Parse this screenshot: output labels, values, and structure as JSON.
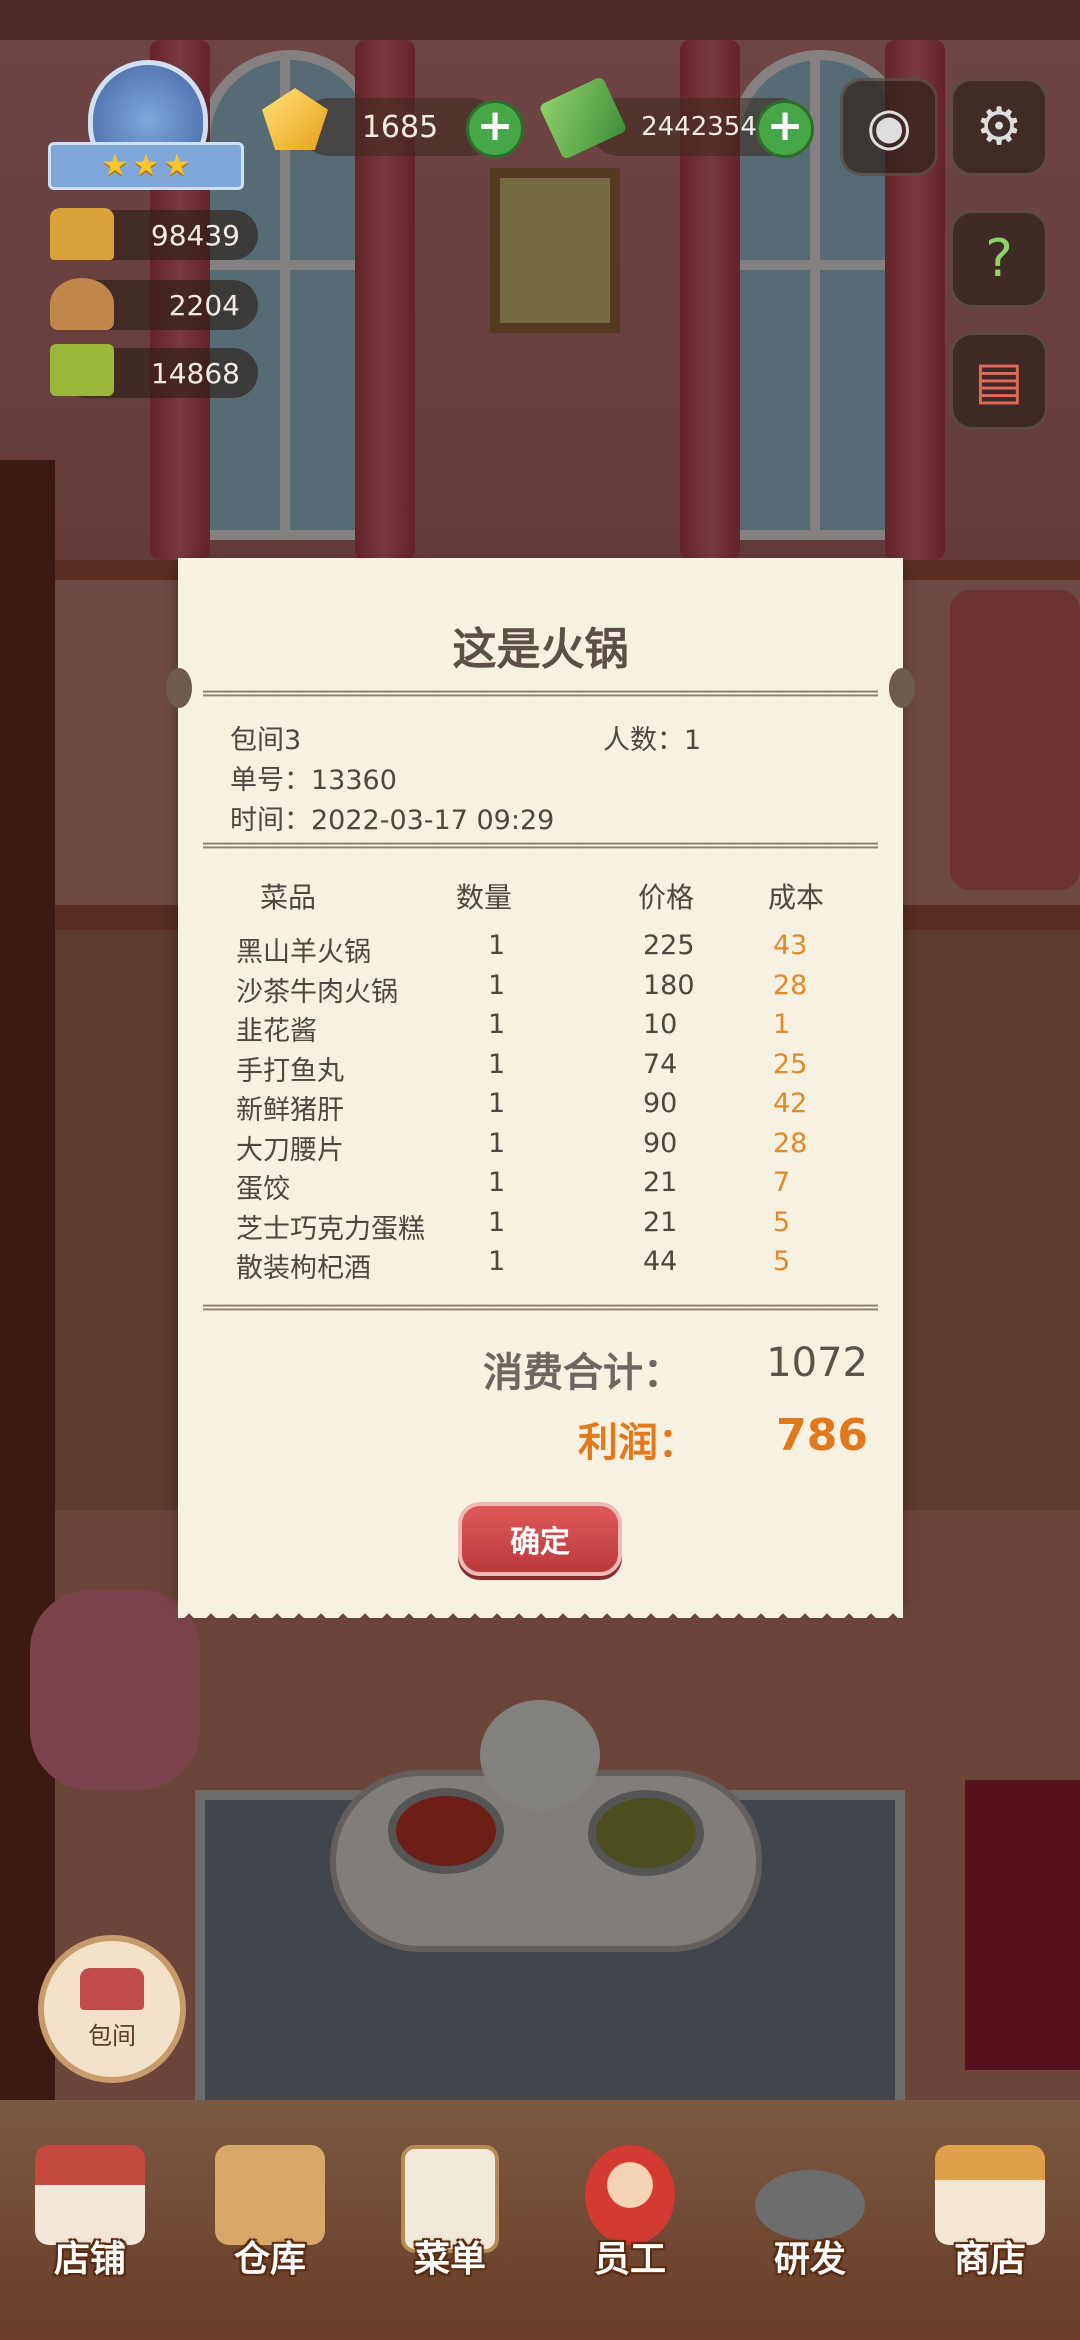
{
  "hud": {
    "gems": "1685",
    "cash": "2442354",
    "stars": 3,
    "side_stats": [
      "98439",
      "2204",
      "14868"
    ]
  },
  "receipt": {
    "title": "这是火锅",
    "room": "包间3",
    "guests_label": "人数：",
    "guests": "1",
    "order_label": "单号：",
    "order_no": "13360",
    "time_label": "时间：",
    "time": "2022-03-17 09:29",
    "headers": {
      "dish": "菜品",
      "qty": "数量",
      "price": "价格",
      "cost": "成本"
    },
    "items": [
      {
        "name": "黑山羊火锅",
        "qty": "1",
        "price": "225",
        "cost": "43"
      },
      {
        "name": "沙茶牛肉火锅",
        "qty": "1",
        "price": "180",
        "cost": "28"
      },
      {
        "name": "韭花酱",
        "qty": "1",
        "price": "10",
        "cost": "1"
      },
      {
        "name": "手打鱼丸",
        "qty": "1",
        "price": "74",
        "cost": "25"
      },
      {
        "name": "新鲜猪肝",
        "qty": "1",
        "price": "90",
        "cost": "42"
      },
      {
        "name": "大刀腰片",
        "qty": "1",
        "price": "90",
        "cost": "28"
      },
      {
        "name": "蛋饺",
        "qty": "1",
        "price": "21",
        "cost": "7"
      },
      {
        "name": "芝士巧克力蛋糕",
        "qty": "1",
        "price": "21",
        "cost": "5"
      },
      {
        "name": "散装枸杞酒",
        "qty": "1",
        "price": "44",
        "cost": "5"
      }
    ],
    "total_label": "消费合计：",
    "total": "1072",
    "profit_label": "利润：",
    "profit": "786",
    "confirm_label": "确定"
  },
  "room_button_label": "包间",
  "nav": {
    "shop": "店铺",
    "warehouse": "仓库",
    "menu": "菜单",
    "staff": "员工",
    "research": "研发",
    "store": "商店"
  },
  "colors": {
    "profit": "#e0791e",
    "cost": "#e08a2a",
    "confirm": "#c94446",
    "plus": "#45a745"
  }
}
